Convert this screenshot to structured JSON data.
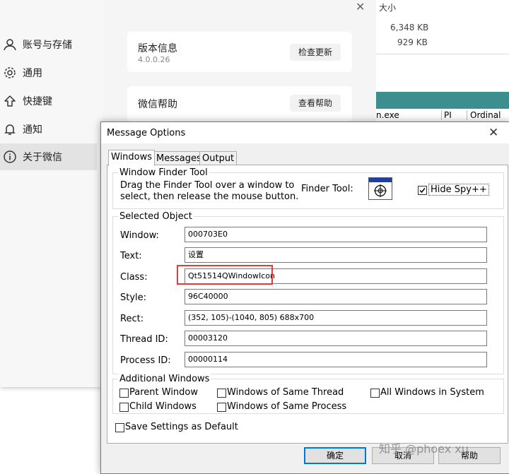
{
  "wechat": {
    "close_glyph": "✕",
    "nav": [
      {
        "label": "账号与存储",
        "icon": "user-icon"
      },
      {
        "label": "通用",
        "icon": "gear-icon"
      },
      {
        "label": "快捷键",
        "icon": "up-arrow-icon"
      },
      {
        "label": "通知",
        "icon": "bell-icon"
      },
      {
        "label": "关于微信",
        "icon": "info-icon",
        "active": true
      }
    ],
    "version_card": {
      "title": "版本信息",
      "version": "4.0.0.26",
      "button": "检查更新"
    },
    "help_card": {
      "title": "微信帮助",
      "button": "查看帮助"
    }
  },
  "files": {
    "size_header": "大小",
    "sizes": [
      "6,348 KB",
      "929 KB"
    ],
    "grid": {
      "col1": "n.exe",
      "col2": "PI",
      "col3": "Ordinal"
    }
  },
  "dialog": {
    "title": "Message Options",
    "close_glyph": "✕",
    "tabs": [
      "Windows",
      "Messages",
      "Output"
    ],
    "finder": {
      "group": "Window Finder Tool",
      "text1": "Drag the Finder Tool over a window to",
      "text2": "select, then release the mouse button.",
      "finder_label": "Finder Tool:",
      "hide_spy": "Hide Spy++",
      "hide_spy_checked": true
    },
    "selected": {
      "group": "Selected Object",
      "fields": [
        {
          "label": "Window:",
          "value": "000703E0"
        },
        {
          "label": "Text:",
          "value": "设置"
        },
        {
          "label": "Class:",
          "value": "Qt51514QWindowIcon"
        },
        {
          "label": "Style:",
          "value": "96C40000"
        },
        {
          "label": "Rect:",
          "value": "(352, 105)-(1040, 805) 688x700"
        },
        {
          "label": "Thread ID:",
          "value": "00003120"
        },
        {
          "label": "Process ID:",
          "value": "00000114"
        }
      ]
    },
    "additional": {
      "group": "Additional Windows",
      "options": [
        "Parent Window",
        "Windows of Same Thread",
        "All Windows in System",
        "Child Windows",
        "Windows of Same Process"
      ]
    },
    "save_default": "Save Settings as Default",
    "buttons": {
      "ok": "确定",
      "cancel": "取消",
      "help": "帮助"
    }
  },
  "watermark": "知乎 @phoex xu",
  "colors": {
    "highlight_box": "#e03c3c",
    "title_strip": "#3d8f8f",
    "focus": "#0078d7"
  }
}
